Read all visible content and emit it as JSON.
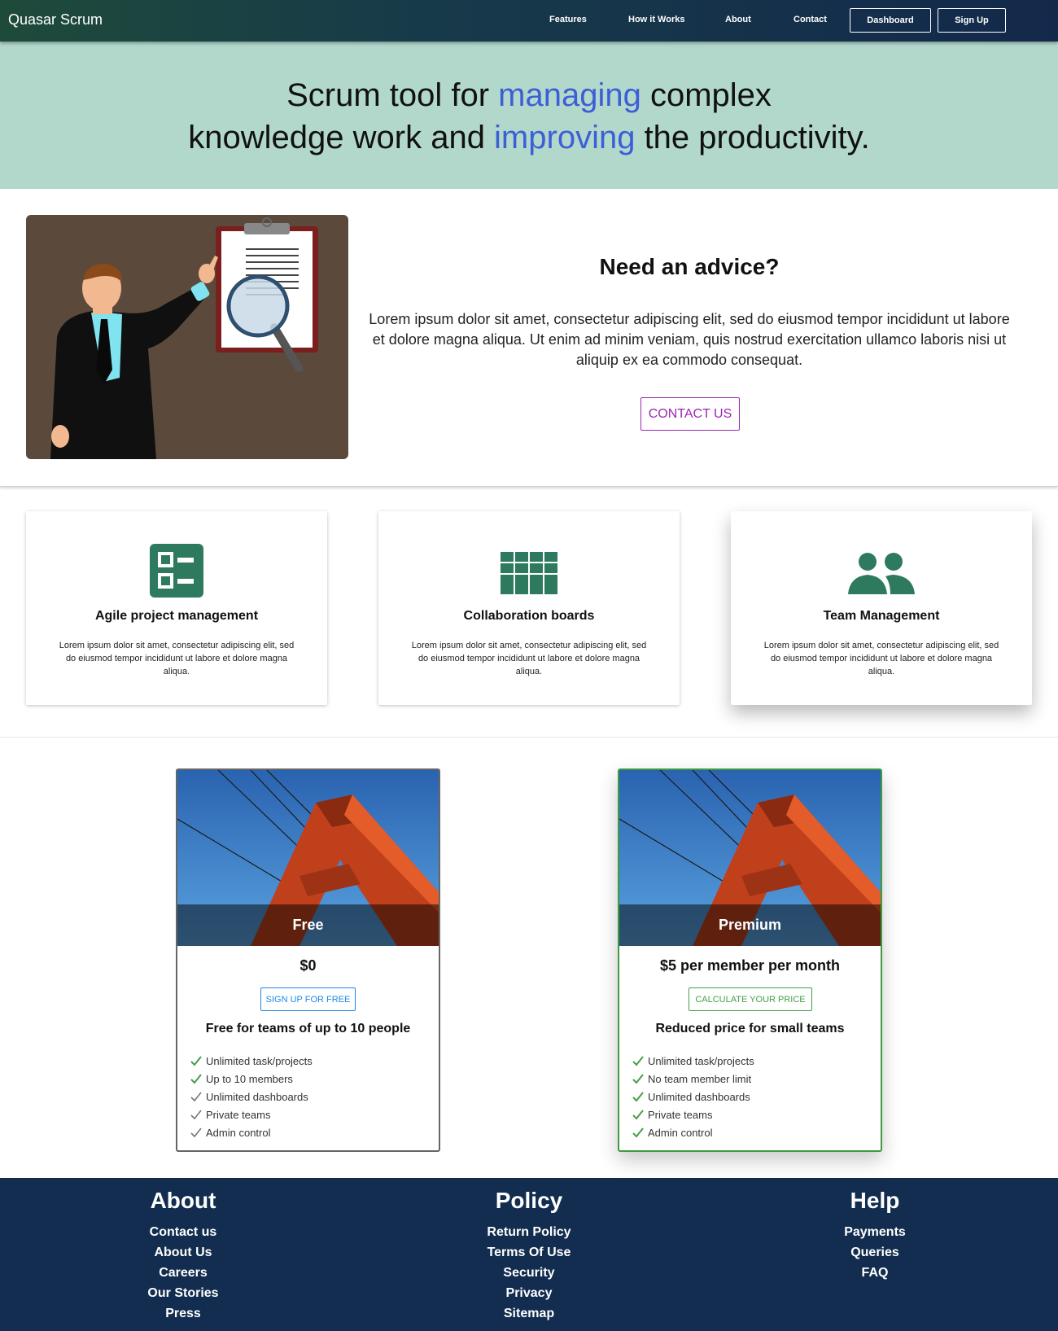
{
  "header": {
    "brand": "Quasar Scrum",
    "nav": [
      "Features",
      "How it Works",
      "About",
      "Contact"
    ],
    "dashboard_label": "Dashboard",
    "signup_label": "Sign Up"
  },
  "hero": {
    "line1_a": "Scrum tool for ",
    "line1_hl": "managing",
    "line1_b": " complex",
    "line2_a": "knowledge work and ",
    "line2_hl": "improving",
    "line2_b": " the productivity.",
    "highlight_color": "#3d5fd6"
  },
  "advice": {
    "title": "Need an advice?",
    "text": "Lorem ipsum dolor sit amet, consectetur adipiscing elit, sed do eiusmod tempor incididunt ut labore et dolore magna aliqua. Ut enim ad minim veniam, quis nostrud exercitation ullamco laboris nisi ut aliquip ex ea commodo consequat.",
    "button_label": "CONTACT US",
    "button_color": "#9c27b0"
  },
  "features": [
    {
      "icon": "checklist-icon",
      "title": "Agile project management",
      "text": "Lorem ipsum dolor sit amet, consectetur adipiscing elit, sed do eiusmod tempor incididunt ut labore et dolore magna aliqua."
    },
    {
      "icon": "grid-icon",
      "title": "Collaboration boards",
      "text": "Lorem ipsum dolor sit amet, consectetur adipiscing elit, sed do eiusmod tempor incididunt ut labore et dolore magna aliqua."
    },
    {
      "icon": "people-icon",
      "title": "Team Management",
      "text": "Lorem ipsum dolor sit amet, consectetur adipiscing elit, sed do eiusmod tempor incididunt ut labore et dolore magna aliqua."
    }
  ],
  "feature_icon_color": "#2e7a5e",
  "pricing": [
    {
      "name": "Free",
      "price": "$0",
      "button_label": "SIGN UP FOR FREE",
      "button_color": "#1e88e5",
      "lead": "Free for teams of up to 10 people",
      "items": [
        "Unlimited task/projects",
        "Up to 10 members",
        "Unlimited dashboards",
        "Private teams",
        "Admin control"
      ]
    },
    {
      "name": "Premium",
      "price": "$5 per member per month",
      "button_label": "CALCULATE YOUR PRICE",
      "button_color": "#43a047",
      "lead": "Reduced price for small teams",
      "items": [
        "Unlimited task/projects",
        "No team member limit",
        "Unlimited dashboards",
        "Private teams",
        "Admin control"
      ]
    }
  ],
  "footer": {
    "columns": [
      {
        "title": "About",
        "links": [
          "Contact us",
          "About Us",
          "Careers",
          "Our Stories",
          "Press"
        ]
      },
      {
        "title": "Policy",
        "links": [
          "Return Policy",
          "Terms Of Use",
          "Security",
          "Privacy",
          "Sitemap"
        ]
      },
      {
        "title": "Help",
        "links": [
          "Payments",
          "Queries",
          "FAQ"
        ]
      }
    ]
  }
}
